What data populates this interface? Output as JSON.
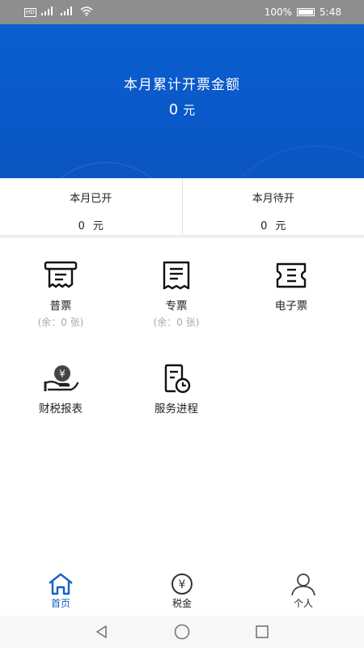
{
  "status_bar": {
    "network": "HD",
    "signal_a": "⁴⁶",
    "signal_b": "⁴⁶",
    "battery": "100%",
    "time": "5:48"
  },
  "hero": {
    "title": "本月累计开票金额",
    "amount": "0",
    "unit": "元"
  },
  "stats": [
    {
      "label": "本月已开",
      "value": "0",
      "unit": "元"
    },
    {
      "label": "本月待开",
      "value": "0",
      "unit": "元"
    }
  ],
  "tiles": [
    {
      "name": "普票",
      "sub": "(余：0 张)",
      "icon": "receipt-icon"
    },
    {
      "name": "专票",
      "sub": "(余：0 张)",
      "icon": "invoice-icon"
    },
    {
      "name": "电子票",
      "sub": "",
      "icon": "ticket-icon"
    },
    {
      "name": "财税报表",
      "sub": "",
      "icon": "money-hand-icon"
    },
    {
      "name": "服务进程",
      "sub": "",
      "icon": "document-clock-icon"
    }
  ],
  "tabbar": [
    {
      "label": "首页",
      "icon": "home-icon",
      "active": true
    },
    {
      "label": "税金",
      "icon": "yen-coin-icon",
      "active": false
    },
    {
      "label": "个人",
      "icon": "person-icon",
      "active": false
    }
  ],
  "colors": {
    "brand_blue": "#0b5fd0",
    "active_tab": "#1a5fc8",
    "muted_text": "#aaaaaa"
  }
}
